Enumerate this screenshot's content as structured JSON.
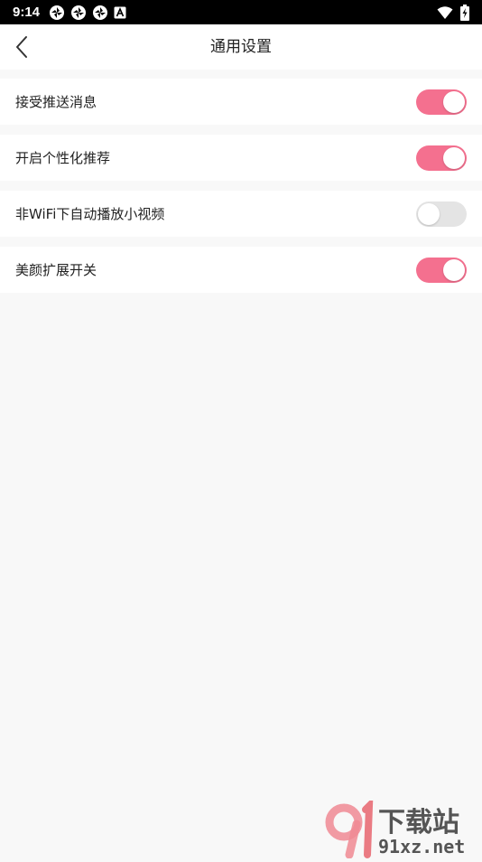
{
  "status_bar": {
    "time": "9:14",
    "notification_icons": [
      "aperture-icon",
      "aperture-icon",
      "aperture-icon",
      "a-box-icon"
    ],
    "right_icons": [
      "wifi-icon",
      "battery-charging-icon"
    ]
  },
  "header": {
    "back_icon": "chevron-left-icon",
    "title": "通用设置"
  },
  "settings": [
    {
      "label": "接受推送消息",
      "enabled": true
    },
    {
      "label": "开启个性化推荐",
      "enabled": true
    },
    {
      "label": "非WiFi下自动播放小视频",
      "enabled": false
    },
    {
      "label": "美颜扩展开关",
      "enabled": true
    }
  ],
  "watermark": {
    "text_cn": "下载站",
    "text_url": "91xz.net"
  },
  "colors": {
    "toggle_on": "#f4708f",
    "toggle_off": "#e4e4e4",
    "background": "#f8f8f8"
  }
}
